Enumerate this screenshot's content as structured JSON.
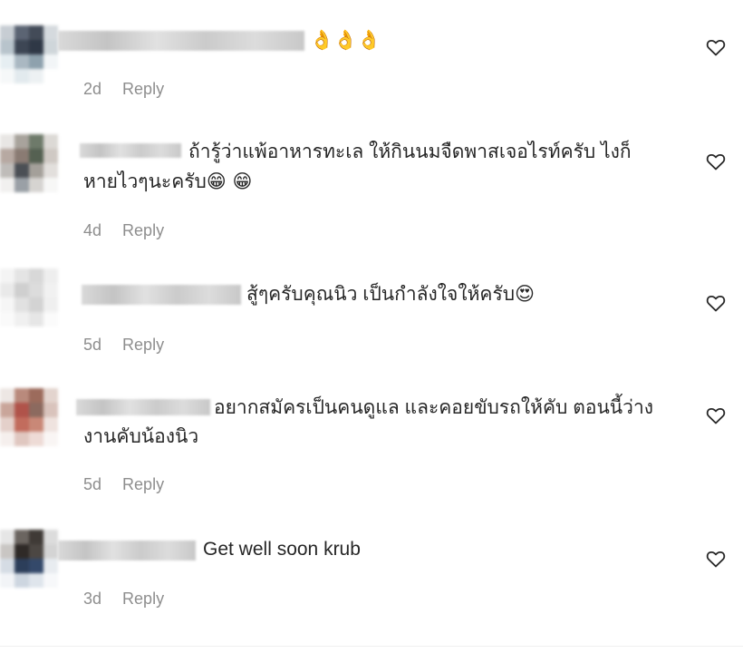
{
  "comments": [
    {
      "text": "",
      "emoji": "👌👌👌",
      "time": "2d",
      "reply": "Reply",
      "avatar_colors": [
        "#c7cdd3",
        "#5b6473",
        "#434b58",
        "#d5dade",
        "#b8c4cc",
        "#3d4654",
        "#2f3846",
        "#cfd6da",
        "#e6eef2",
        "#aab8c2",
        "#8ea1ad",
        "#f2f5f7",
        "#f6f8f9",
        "#e2eaee",
        "#edf1f3",
        "#ffffff"
      ]
    },
    {
      "text_line1": "ถ้ารู้ว่าแพ้อาหารทะเล ให้กินนมจืดพาสเจอไรท์ครับ ไงก็",
      "text_line2": "หายไวๆนะครับ",
      "emoji": "😁 😁",
      "time": "4d",
      "reply": "Reply",
      "avatar_colors": [
        "#e8e6e4",
        "#a8a39c",
        "#6e7a6a",
        "#dcd9d5",
        "#b7a9a2",
        "#8a7b73",
        "#556152",
        "#cfc9c4",
        "#bfbcb9",
        "#4b4f55",
        "#a4a09a",
        "#e2dfdc",
        "#f1f0ef",
        "#9aa0a6",
        "#d6d4d1",
        "#f7f7f6"
      ]
    },
    {
      "text": "สู้ๆครับคุณนิว เป็นกำลังใจให้ครับ",
      "emoji": "😍",
      "time": "5d",
      "reply": "Reply",
      "avatar_colors": [
        "#f4f4f4",
        "#e4e4e4",
        "#d8d8d8",
        "#eeeeee",
        "#e9e9e9",
        "#cfcfcf",
        "#dcdcdc",
        "#f1f1f1",
        "#f6f6f6",
        "#e1e1e1",
        "#d3d3d3",
        "#efefef",
        "#fafafa",
        "#f0f0f0",
        "#e6e6e6",
        "#fbfbfb"
      ]
    },
    {
      "text_line1": "อยากสมัครเป็นคนดูแล และคอยขับรถให้คับ ตอนนี้ว่าง",
      "text_line2": "งานคับน้องนิว",
      "emoji": "",
      "time": "5d",
      "reply": "Reply",
      "avatar_colors": [
        "#ede7e4",
        "#b98a7c",
        "#9c6b5c",
        "#e3d4ce",
        "#c9a59a",
        "#b0534a",
        "#8c6a5f",
        "#d9c3bc",
        "#e4d0ca",
        "#c26c5d",
        "#c98877",
        "#efe3df",
        "#f5efed",
        "#e0c7c0",
        "#eedbd6",
        "#f9f5f4"
      ]
    },
    {
      "text": "Get well soon krub",
      "emoji": "",
      "time": "3d",
      "reply": "Reply",
      "avatar_colors": [
        "#e6e6e6",
        "#6b6560",
        "#3f3a36",
        "#dcdcdc",
        "#c9c6c3",
        "#2f2a27",
        "#4c4743",
        "#d4d4d4",
        "#d5dce4",
        "#2c3e5a",
        "#34496a",
        "#e8ecf0",
        "#f2f4f7",
        "#cdd6e0",
        "#dfe5ec",
        "#f7f8fa"
      ]
    }
  ]
}
